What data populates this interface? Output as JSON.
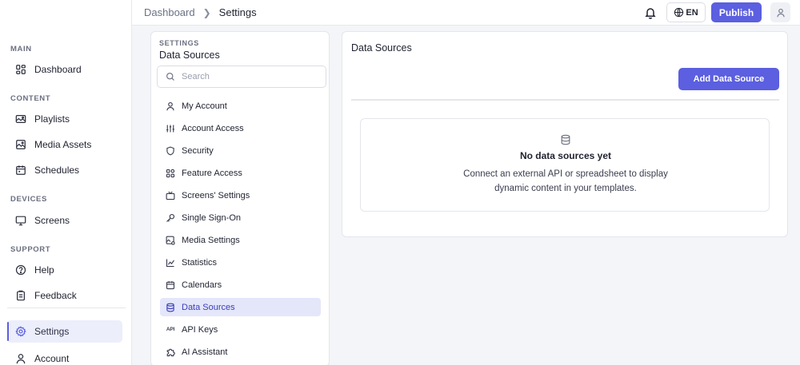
{
  "nav": {
    "sections": [
      {
        "title": "MAIN",
        "items": [
          {
            "label": "Dashboard",
            "icon": "grid-icon"
          }
        ]
      },
      {
        "title": "CONTENT",
        "items": [
          {
            "label": "Playlists",
            "icon": "playlist-icon"
          },
          {
            "label": "Media Assets",
            "icon": "image-icon"
          },
          {
            "label": "Schedules",
            "icon": "calendar-icon"
          }
        ]
      },
      {
        "title": "DEVICES",
        "items": [
          {
            "label": "Screens",
            "icon": "monitor-icon"
          }
        ]
      },
      {
        "title": "SUPPORT",
        "items": [
          {
            "label": "Help",
            "icon": "help-icon"
          },
          {
            "label": "Feedback",
            "icon": "feedback-icon"
          }
        ]
      }
    ],
    "settings_label": "Settings",
    "account_label": "Account",
    "active_color": "#5b5fe0"
  },
  "topbar": {
    "breadcrumb_root": "Dashboard",
    "breadcrumb_current": "Settings",
    "lang_label": "EN",
    "publish_label": "Publish"
  },
  "settings_panel": {
    "kicker": "SETTINGS",
    "title": "Data Sources",
    "search_placeholder": "Search",
    "search_value": "",
    "items": [
      {
        "label": "My Account",
        "icon": "user-icon"
      },
      {
        "label": "Account Access",
        "icon": "sliders-icon"
      },
      {
        "label": "Security",
        "icon": "shield-icon"
      },
      {
        "label": "Feature Access",
        "icon": "apps-icon"
      },
      {
        "label": "Screens' Settings",
        "icon": "tv-icon"
      },
      {
        "label": "Single Sign-On",
        "icon": "key-icon"
      },
      {
        "label": "Media Settings",
        "icon": "media-settings-icon"
      },
      {
        "label": "Statistics",
        "icon": "chart-icon"
      },
      {
        "label": "Calendars",
        "icon": "calendar-icon"
      },
      {
        "label": "Data Sources",
        "icon": "database-icon",
        "active": true
      },
      {
        "label": "API Keys",
        "icon": "api-icon",
        "glyph": "API"
      },
      {
        "label": "AI Assistant",
        "icon": "puzzle-icon"
      }
    ]
  },
  "main": {
    "title": "Data Sources",
    "add_button_label": "Add Data Source",
    "empty": {
      "title": "No data sources yet",
      "line1": "Connect an external API or spreadsheet to display",
      "line2": "dynamic content in your templates."
    }
  },
  "colors": {
    "accent": "#5b5fe0",
    "active_bg": "#e4e6fa",
    "background": "#f4f5f8"
  }
}
